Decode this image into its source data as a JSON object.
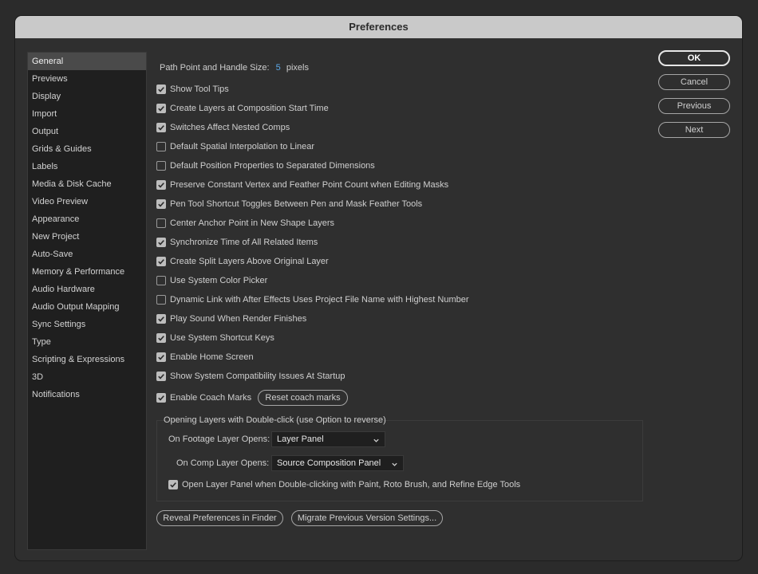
{
  "dialog": {
    "title": "Preferences"
  },
  "sidebar": {
    "items": [
      {
        "label": "General",
        "selected": true
      },
      {
        "label": "Previews"
      },
      {
        "label": "Display"
      },
      {
        "label": "Import"
      },
      {
        "label": "Output"
      },
      {
        "label": "Grids & Guides"
      },
      {
        "label": "Labels"
      },
      {
        "label": "Media & Disk Cache"
      },
      {
        "label": "Video Preview"
      },
      {
        "label": "Appearance"
      },
      {
        "label": "New Project"
      },
      {
        "label": "Auto-Save"
      },
      {
        "label": "Memory & Performance"
      },
      {
        "label": "Audio Hardware"
      },
      {
        "label": "Audio Output Mapping"
      },
      {
        "label": "Sync Settings"
      },
      {
        "label": "Type"
      },
      {
        "label": "Scripting & Expressions"
      },
      {
        "label": "3D"
      },
      {
        "label": "Notifications"
      }
    ]
  },
  "general": {
    "path_size": {
      "label": "Path Point and Handle Size:",
      "value": "5",
      "unit": "pixels"
    },
    "checkboxes": [
      {
        "label": "Show Tool Tips",
        "checked": true
      },
      {
        "label": "Create Layers at Composition Start Time",
        "checked": true
      },
      {
        "label": "Switches Affect Nested Comps",
        "checked": true
      },
      {
        "label": "Default Spatial Interpolation to Linear",
        "checked": false
      },
      {
        "label": "Default Position Properties to Separated Dimensions",
        "checked": false
      },
      {
        "label": "Preserve Constant Vertex and Feather Point Count when Editing Masks",
        "checked": true
      },
      {
        "label": "Pen Tool Shortcut Toggles Between Pen and Mask Feather Tools",
        "checked": true
      },
      {
        "label": "Center Anchor Point in New Shape Layers",
        "checked": false
      },
      {
        "label": "Synchronize Time of All Related Items",
        "checked": true
      },
      {
        "label": "Create Split Layers Above Original Layer",
        "checked": true
      },
      {
        "label": "Use System Color Picker",
        "checked": false
      },
      {
        "label": "Dynamic Link with After Effects Uses Project File Name with Highest Number",
        "checked": false
      },
      {
        "label": "Play Sound When Render Finishes",
        "checked": true
      },
      {
        "label": "Use System Shortcut Keys",
        "checked": true
      },
      {
        "label": "Enable Home Screen",
        "checked": true
      },
      {
        "label": "Show System Compatibility Issues At Startup",
        "checked": true
      },
      {
        "label": "Enable Coach Marks",
        "checked": true
      }
    ],
    "reset_coach_marks": "Reset coach marks",
    "double_click_group": {
      "title": "Opening Layers with Double-click (use Option to reverse)",
      "footage_label": "On Footage Layer Opens:",
      "footage_value": "Layer Panel",
      "comp_label": "On Comp Layer Opens:",
      "comp_value": "Source Composition Panel",
      "open_layer_panel": {
        "label": "Open Layer Panel when Double-clicking with Paint, Roto Brush, and Refine Edge Tools",
        "checked": true
      }
    },
    "reveal_button": "Reveal Preferences in Finder",
    "migrate_button": "Migrate Previous Version Settings..."
  },
  "actions": {
    "ok": "OK",
    "cancel": "Cancel",
    "previous": "Previous",
    "next": "Next"
  },
  "icons": {
    "check": "checkmark-icon",
    "chevron": "chevron-down-icon"
  }
}
